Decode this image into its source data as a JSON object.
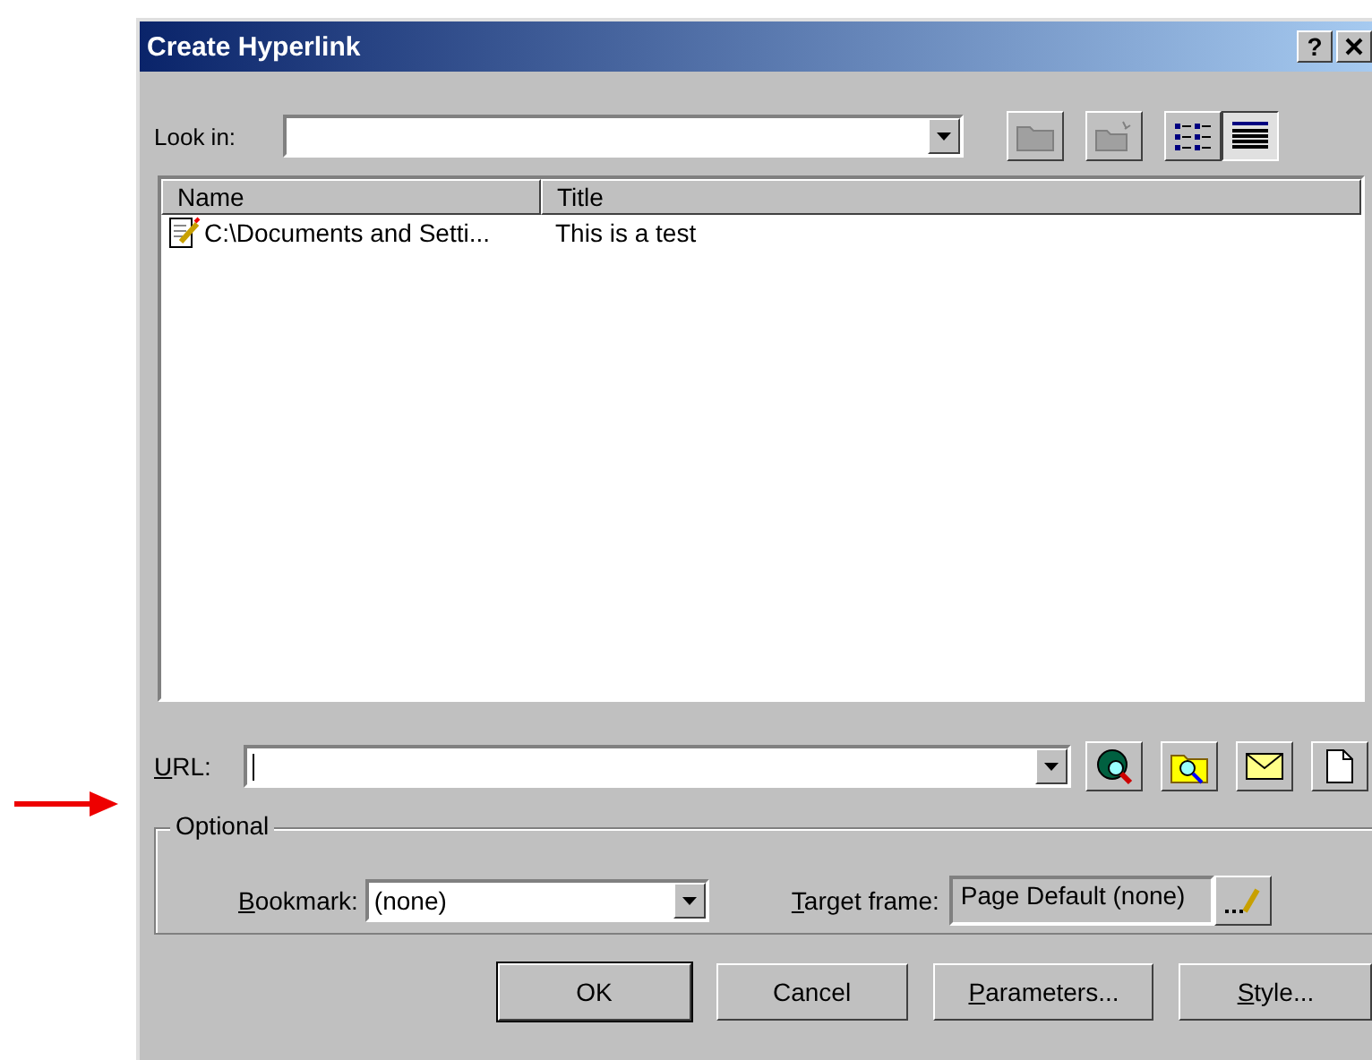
{
  "window": {
    "title": "Create Hyperlink",
    "help": "?"
  },
  "look_in": {
    "label": "Look in:"
  },
  "toolbar": [
    {
      "kind": "up-folder",
      "disabled": true,
      "selected": false
    },
    {
      "kind": "new-folder",
      "disabled": true,
      "selected": false
    },
    {
      "kind": "list-view",
      "disabled": false,
      "selected": false
    },
    {
      "kind": "details-view",
      "disabled": false,
      "selected": true
    }
  ],
  "file_list": {
    "columns": [
      "Name",
      "Title"
    ],
    "rows": [
      {
        "name": "C:\\Documents and Setti...",
        "title": "This is a test"
      }
    ]
  },
  "url": {
    "label": "URL:",
    "mnemonic": true
  },
  "url_buttons": [
    {
      "kind": "web"
    },
    {
      "kind": "browse"
    },
    {
      "kind": "email"
    },
    {
      "kind": "new-page"
    }
  ],
  "optional": {
    "title": "Optional",
    "bookmark": {
      "label": "Bookmark:",
      "mnemonic": true,
      "value": "(none)"
    },
    "target_frame": {
      "label": "Target frame:",
      "mnemonic": true,
      "value": "Page Default (none)"
    }
  },
  "buttons": [
    {
      "label": "OK",
      "mnemonic": false,
      "default": true
    },
    {
      "label": "Cancel",
      "mnemonic": false,
      "default": false
    },
    {
      "label": "Parameters...",
      "mnemonic": true,
      "default": false
    },
    {
      "label": "Style...",
      "mnemonic": true,
      "default": false
    }
  ]
}
